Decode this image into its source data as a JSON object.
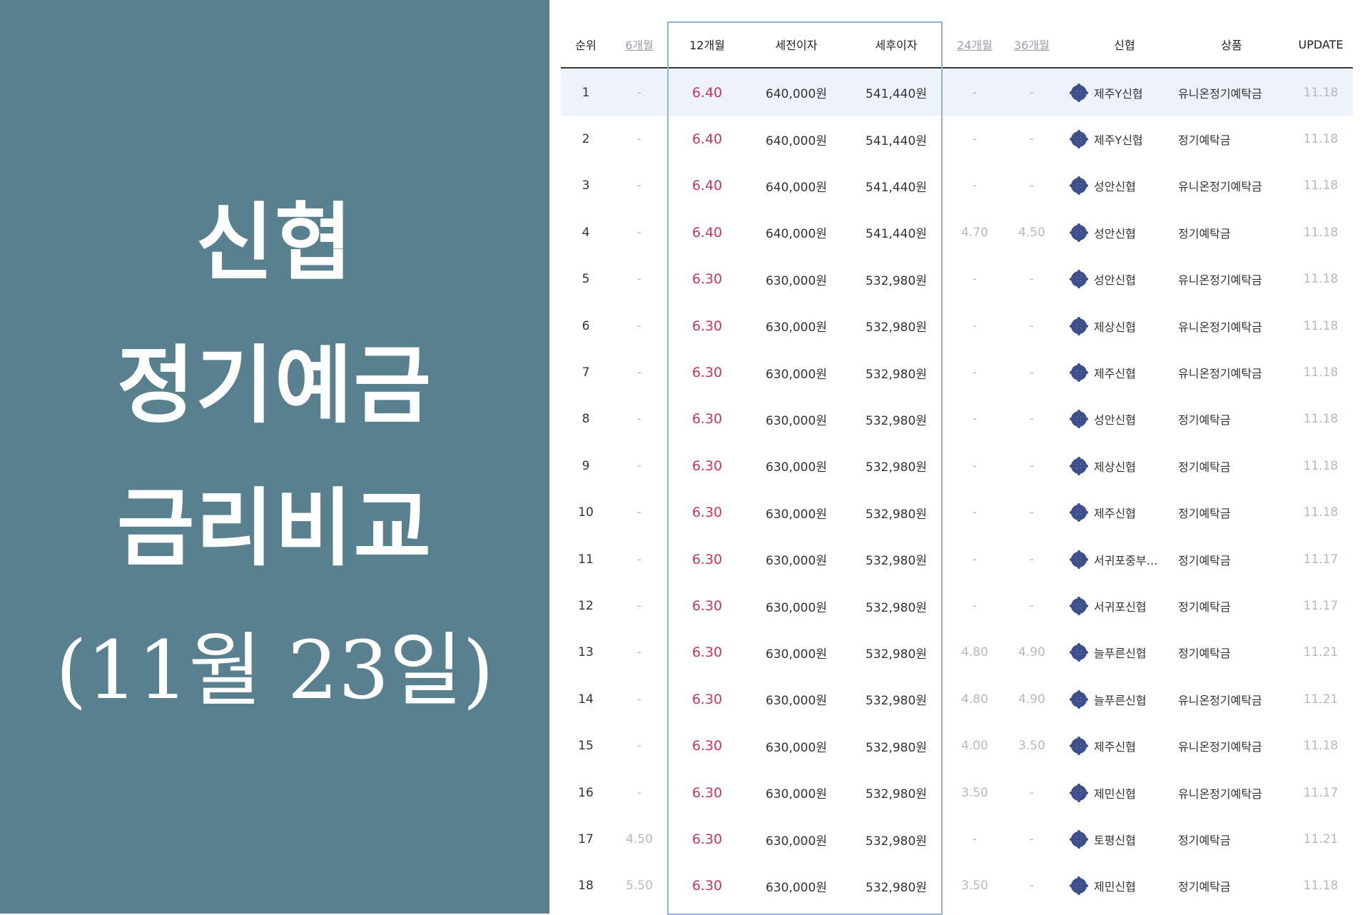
{
  "title": {
    "line1": "신협",
    "line2": "정기예금",
    "line3": "금리비교",
    "line4": "(11월 23일)"
  },
  "table": {
    "headers": {
      "rank": "순위",
      "m6": "6개월",
      "m12": "12개월",
      "pre_tax": "세전이자",
      "post_tax": "세후이자",
      "m24": "24개월",
      "m36": "36개월",
      "bank": "신협",
      "product": "상품",
      "update": "UPDATE"
    },
    "rows": [
      {
        "rank": "1",
        "m6": "-",
        "m12": "6.40",
        "pre": "640,000원",
        "post": "541,440원",
        "m24": "-",
        "m36": "-",
        "bank": "제주Y신협",
        "product": "유니온정기예탁금",
        "update": "11.18"
      },
      {
        "rank": "2",
        "m6": "-",
        "m12": "6.40",
        "pre": "640,000원",
        "post": "541,440원",
        "m24": "-",
        "m36": "-",
        "bank": "제주Y신협",
        "product": "정기예탁금",
        "update": "11.18"
      },
      {
        "rank": "3",
        "m6": "-",
        "m12": "6.40",
        "pre": "640,000원",
        "post": "541,440원",
        "m24": "-",
        "m36": "-",
        "bank": "성안신협",
        "product": "유니온정기예탁금",
        "update": "11.18"
      },
      {
        "rank": "4",
        "m6": "-",
        "m12": "6.40",
        "pre": "640,000원",
        "post": "541,440원",
        "m24": "4.70",
        "m36": "4.50",
        "bank": "성안신협",
        "product": "정기예탁금",
        "update": "11.18"
      },
      {
        "rank": "5",
        "m6": "-",
        "m12": "6.30",
        "pre": "630,000원",
        "post": "532,980원",
        "m24": "-",
        "m36": "-",
        "bank": "성안신협",
        "product": "유니온정기예탁금",
        "update": "11.18"
      },
      {
        "rank": "6",
        "m6": "-",
        "m12": "6.30",
        "pre": "630,000원",
        "post": "532,980원",
        "m24": "-",
        "m36": "-",
        "bank": "제상신협",
        "product": "유니온정기예탁금",
        "update": "11.18"
      },
      {
        "rank": "7",
        "m6": "-",
        "m12": "6.30",
        "pre": "630,000원",
        "post": "532,980원",
        "m24": "-",
        "m36": "-",
        "bank": "제주신협",
        "product": "유니온정기예탁금",
        "update": "11.18"
      },
      {
        "rank": "8",
        "m6": "-",
        "m12": "6.30",
        "pre": "630,000원",
        "post": "532,980원",
        "m24": "-",
        "m36": "-",
        "bank": "성안신협",
        "product": "정기예탁금",
        "update": "11.18"
      },
      {
        "rank": "9",
        "m6": "-",
        "m12": "6.30",
        "pre": "630,000원",
        "post": "532,980원",
        "m24": "-",
        "m36": "-",
        "bank": "제상신협",
        "product": "정기예탁금",
        "update": "11.18"
      },
      {
        "rank": "10",
        "m6": "-",
        "m12": "6.30",
        "pre": "630,000원",
        "post": "532,980원",
        "m24": "-",
        "m36": "-",
        "bank": "제주신협",
        "product": "정기예탁금",
        "update": "11.18"
      },
      {
        "rank": "11",
        "m6": "-",
        "m12": "6.30",
        "pre": "630,000원",
        "post": "532,980원",
        "m24": "-",
        "m36": "-",
        "bank": "서귀포중부…",
        "product": "정기예탁금",
        "update": "11.17"
      },
      {
        "rank": "12",
        "m6": "-",
        "m12": "6.30",
        "pre": "630,000원",
        "post": "532,980원",
        "m24": "-",
        "m36": "-",
        "bank": "서귀포신협",
        "product": "정기예탁금",
        "update": "11.17"
      },
      {
        "rank": "13",
        "m6": "-",
        "m12": "6.30",
        "pre": "630,000원",
        "post": "532,980원",
        "m24": "4.80",
        "m36": "4.90",
        "bank": "늘푸른신협",
        "product": "정기예탁금",
        "update": "11.21"
      },
      {
        "rank": "14",
        "m6": "-",
        "m12": "6.30",
        "pre": "630,000원",
        "post": "532,980원",
        "m24": "4.80",
        "m36": "4.90",
        "bank": "늘푸른신협",
        "product": "유니온정기예탁금",
        "update": "11.21"
      },
      {
        "rank": "15",
        "m6": "-",
        "m12": "6.30",
        "pre": "630,000원",
        "post": "532,980원",
        "m24": "4.00",
        "m36": "3.50",
        "bank": "제주신협",
        "product": "유니온정기예탁금",
        "update": "11.18"
      },
      {
        "rank": "16",
        "m6": "-",
        "m12": "6.30",
        "pre": "630,000원",
        "post": "532,980원",
        "m24": "3.50",
        "m36": "-",
        "bank": "제민신협",
        "product": "유니온정기예탁금",
        "update": "11.17"
      },
      {
        "rank": "17",
        "m6": "4.50",
        "m12": "6.30",
        "pre": "630,000원",
        "post": "532,980원",
        "m24": "-",
        "m36": "-",
        "bank": "토평신협",
        "product": "정기예탁금",
        "update": "11.21"
      },
      {
        "rank": "18",
        "m6": "5.50",
        "m12": "6.30",
        "pre": "630,000원",
        "post": "532,980원",
        "m24": "3.50",
        "m36": "-",
        "bank": "제민신협",
        "product": "정기예탁금",
        "update": "11.18"
      }
    ]
  },
  "colors": {
    "panel_bg": "#58808f",
    "rate_highlight": "#c8375a",
    "column_frame": "#8fb3dd",
    "first_row_bg": "#eef3fb"
  }
}
